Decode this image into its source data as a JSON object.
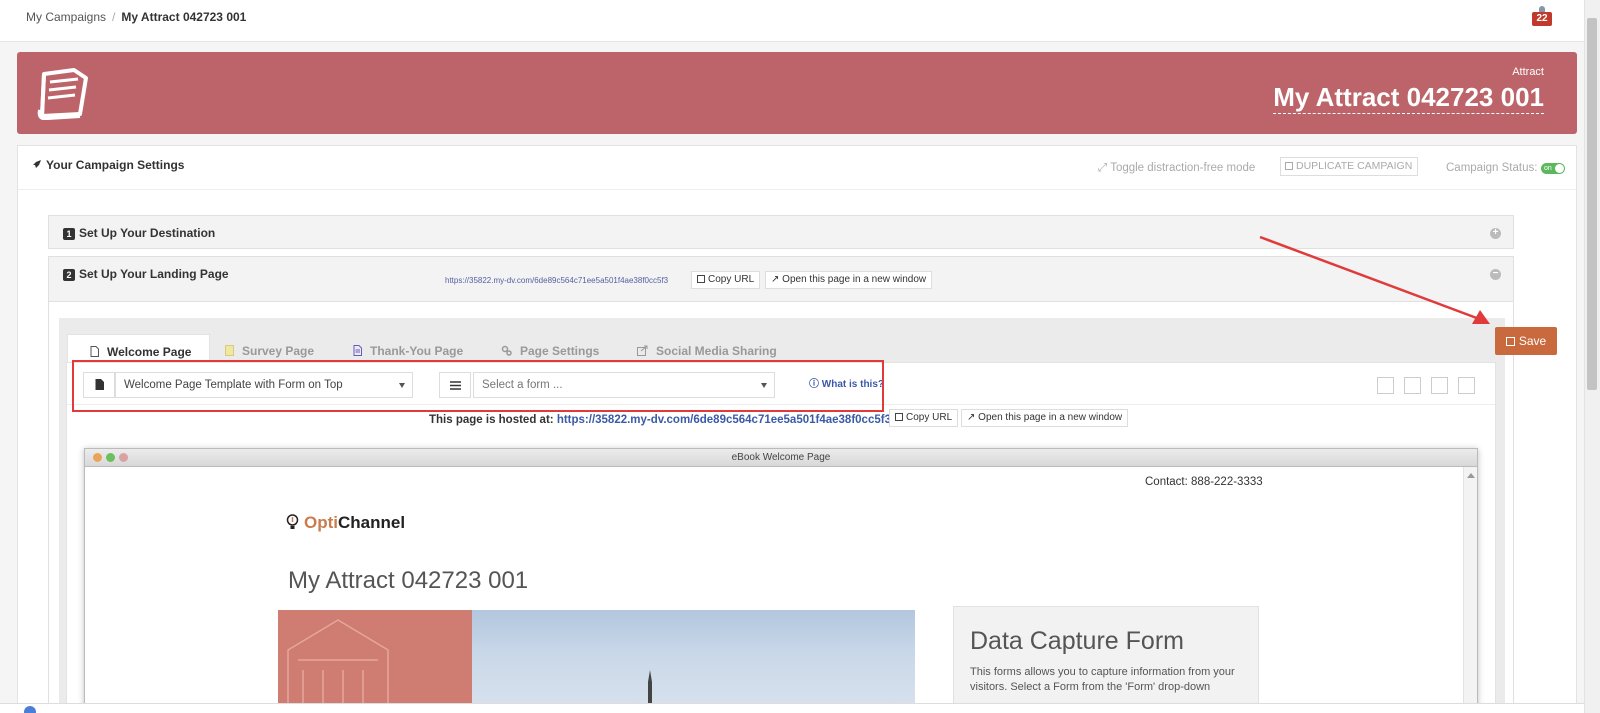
{
  "breadcrumb": {
    "parent": "My Campaigns",
    "current": "My Attract 042723 001"
  },
  "notifications": {
    "count": "22"
  },
  "header": {
    "subtitle": "Attract",
    "title": "My Attract 042723 001",
    "color": "#bc6469"
  },
  "settings": {
    "title": "Your Campaign Settings",
    "toggle_label": "Toggle distraction-free mode",
    "duplicate_label": "DUPLICATE CAMPAIGN",
    "status_label": "Campaign Status:",
    "status_value": "on"
  },
  "steps": [
    {
      "num": "1",
      "title": "Set Up Your Destination"
    },
    {
      "num": "2",
      "title": "Set Up Your Landing Page",
      "url": "https://35822.my-dv.com/6de89c564c71ee5a501f4ae38f0cc5f3",
      "copy_label": "Copy URL",
      "open_label": "Open this page in a new window"
    }
  ],
  "tabs": [
    {
      "label": "Welcome Page",
      "active": true
    },
    {
      "label": "Survey Page"
    },
    {
      "label": "Thank-You Page"
    },
    {
      "label": "Page Settings"
    },
    {
      "label": "Social Media Sharing"
    }
  ],
  "editor": {
    "template_value": "Welcome Page Template with Form on Top",
    "form_placeholder": "Select a form ...",
    "what_is_this": "What is this?",
    "hosted_label": "This page is hosted at:",
    "hosted_url": "https://35822.my-dv.com/6de89c564c71ee5a501f4ae38f0cc5f3",
    "copy_label": "Copy URL",
    "open_label": "Open this page in a new window"
  },
  "preview": {
    "window_title": "eBook Welcome Page",
    "contact": "Contact: 888-222-3333",
    "logo_opti": "Opti",
    "logo_channel": "Channel",
    "page_title": "My Attract 042723 001",
    "form_title": "Data Capture Form",
    "form_text": "This forms allows you to capture information from your visitors. Select a Form from the 'Form' drop-down"
  },
  "save_label": "Save",
  "colors": {
    "accent": "#c96a3e",
    "annotation": "#e03a3a",
    "link": "#3a5aa8"
  }
}
